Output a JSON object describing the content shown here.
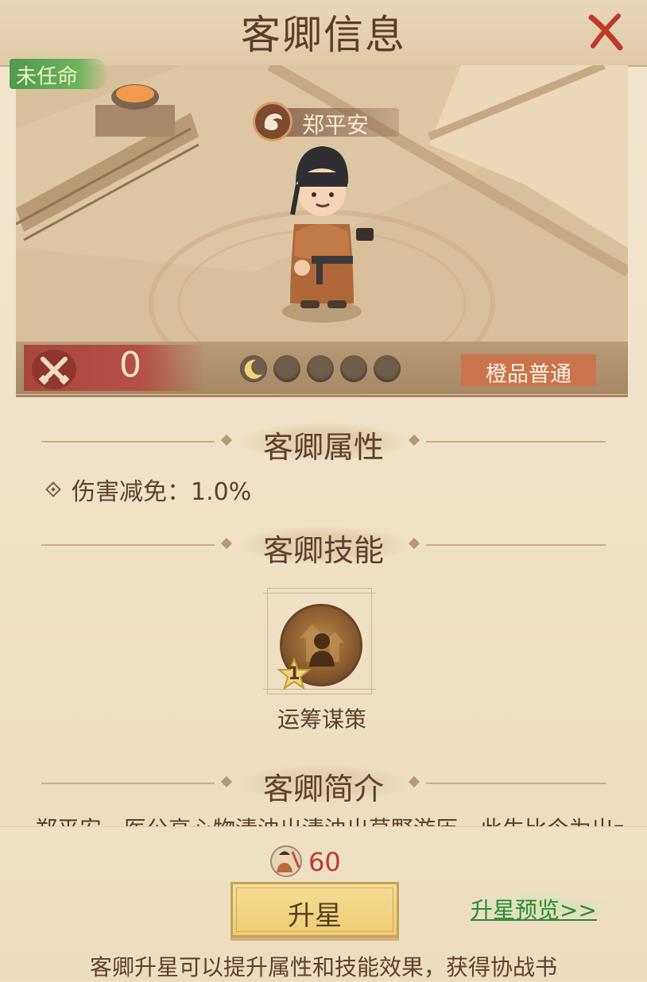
{
  "header": {
    "title": "客卿信息",
    "close_icon": "close-icon"
  },
  "scene": {
    "status_tag": "未任命",
    "character_name": "郑平安",
    "character_badge_icon": "dragon-emblem-icon",
    "power_icon": "crossed-swords-icon",
    "power_value": "0",
    "star_level": {
      "filled": 1,
      "total": 5,
      "filled_icon": "crescent-moon-icon",
      "empty_icon": "empty-star-slot-icon"
    },
    "quality": "橙品普通"
  },
  "attributes": {
    "title": "客卿属性",
    "items": [
      {
        "text": "伤害减免：1.0%"
      }
    ]
  },
  "skills": {
    "title": "客卿技能",
    "items": [
      {
        "name": "运筹谋策",
        "level": "1",
        "icon": "strategy-skill-icon"
      }
    ]
  },
  "intro": {
    "title": "客卿简介",
    "text_partial": "郑平安，医公高心物清浊出清浊出草野游历，此生比今为出士"
  },
  "upgrade": {
    "cost_icon": "advisor-token-icon",
    "cost_amount": "60",
    "button_label": "升星",
    "preview_link": "升星预览>>",
    "hint": "客卿升星可以提升属性和技能效果，获得协战书"
  },
  "colors": {
    "accent_red": "#c0392b",
    "link_green": "#2e8a36",
    "button_gold": "#efcb73",
    "quality_orange": "#c9744e",
    "status_green": "#5fa953"
  }
}
